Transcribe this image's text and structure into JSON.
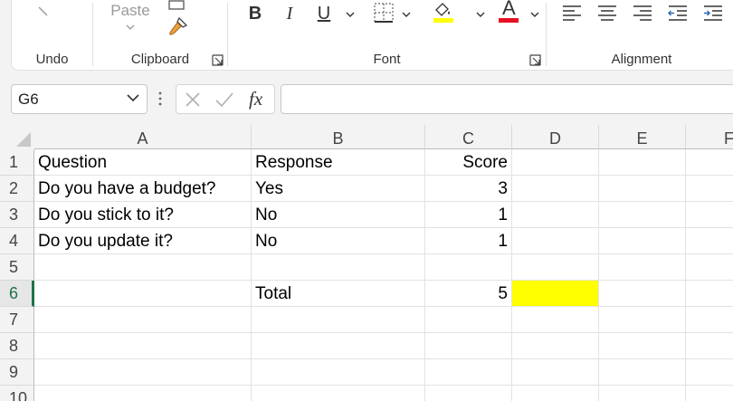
{
  "ribbon": {
    "undo": {
      "label": "Undo"
    },
    "clipboard": {
      "paste_label": "Paste",
      "label": "Clipboard"
    },
    "font": {
      "label": "Font",
      "bold": "B",
      "italic": "I",
      "underline": "U",
      "font_color_letter": "A",
      "highlight_color": "#ffff00",
      "font_color": "#e81123"
    },
    "alignment": {
      "label": "Alignment"
    }
  },
  "formula_bar": {
    "name_box": "G6",
    "fx": "fx",
    "formula": ""
  },
  "sheet": {
    "columns": [
      "A",
      "B",
      "C",
      "D",
      "E",
      "F"
    ],
    "rows": [
      "1",
      "2",
      "3",
      "4",
      "5",
      "6",
      "7",
      "8",
      "9",
      "10"
    ],
    "selected_row": "6",
    "cells": {
      "A1": "Question",
      "B1": "Response",
      "C1": "Score",
      "A2": "Do you have a budget?",
      "B2": "Yes",
      "C2": "3",
      "A3": "Do you stick to it?",
      "B3": "No",
      "C3": "1",
      "A4": "Do you update it?",
      "B4": "No",
      "C4": "1",
      "B6": "Total",
      "C6": "5"
    },
    "highlight_color": "#ffff00"
  }
}
